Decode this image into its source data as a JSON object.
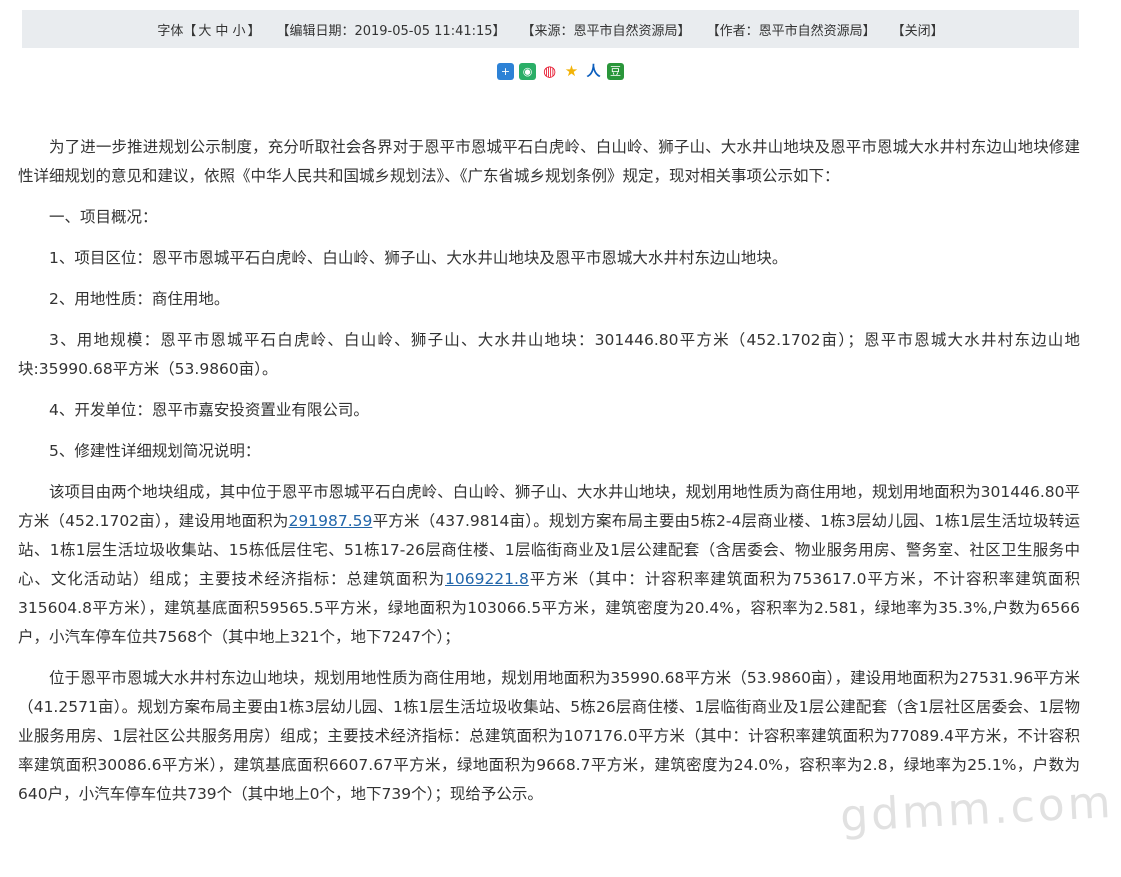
{
  "topbar": {
    "font_label": "字体【",
    "size_large": "大",
    "size_medium": "中",
    "size_small": "小",
    "font_label_end": "】",
    "edit_date": "【编辑日期：2019-05-05 11:41:15】",
    "source": "【来源：恩平市自然资源局】",
    "author": "【作者：恩平市自然资源局】",
    "close": "【关闭】"
  },
  "share": {
    "icons": [
      {
        "name": "share-more-icon",
        "glyph": "+",
        "color": "#2d82d6"
      },
      {
        "name": "wechat-icon",
        "glyph": "◉",
        "color": "#2aae67"
      },
      {
        "name": "weibo-icon",
        "glyph": "◍",
        "color": "#e6162d"
      },
      {
        "name": "qzone-icon",
        "glyph": "★",
        "color": "#f2b308"
      },
      {
        "name": "renren-icon",
        "glyph": "人",
        "color": "#0b5ebd"
      },
      {
        "name": "douban-icon",
        "glyph": "豆",
        "color": "#2a963a"
      }
    ]
  },
  "article": {
    "p1": "为了进一步推进规划公示制度，充分听取社会各界对于恩平市恩城平石白虎岭、白山岭、狮子山、大水井山地块及恩平市恩城大水井村东边山地块修建性详细规划的意见和建议，依照《中华人民共和国城乡规划法》、《广东省城乡规划条例》规定，现对相关事项公示如下：",
    "p2": "一、项目概况：",
    "p3": "1、项目区位：恩平市恩城平石白虎岭、白山岭、狮子山、大水井山地块及恩平市恩城大水井村东边山地块。",
    "p4": "2、用地性质：商住用地。",
    "p5": "3、用地规模：恩平市恩城平石白虎岭、白山岭、狮子山、大水井山地块：301446.80平方米（452.1702亩）；恩平市恩城大水井村东边山地块:35990.68平方米（53.9860亩）。",
    "p6": "4、开发单位：恩平市嘉安投资置业有限公司。",
    "p7": "5、修建性详细规划简况说明：",
    "p8_a": "该项目由两个地块组成，其中位于恩平市恩城平石白虎岭、白山岭、狮子山、大水井山地块，规划用地性质为商住用地，规划用地面积为301446.80平方米（452.1702亩），建设用地面积为",
    "p8_link1": "291987.59",
    "p8_b": "平方米（437.9814亩）。规划方案布局主要由5栋2-4层商业楼、1栋3层幼儿园、1栋1层生活垃圾转运站、1栋1层生活垃圾收集站、15栋低层住宅、51栋17-26层商住楼、1层临街商业及1层公建配套（含居委会、物业服务用房、警务室、社区卫生服务中心、文化活动站）组成；主要技术经济指标：总建筑面积为",
    "p8_link2": "1069221.8",
    "p8_c": "平方米（其中：计容积率建筑面积为753617.0平方米，不计容积率建筑面积315604.8平方米），建筑基底面积59565.5平方米，绿地面积为103066.5平方米，建筑密度为20.4%，容积率为2.581，绿地率为35.3%,户数为6566户，小汽车停车位共7568个（其中地上321个，地下7247个）；",
    "p9": "位于恩平市恩城大水井村东边山地块，规划用地性质为商住用地，规划用地面积为35990.68平方米（53.9860亩），建设用地面积为27531.96平方米（41.2571亩）。规划方案布局主要由1栋3层幼儿园、1栋1层生活垃圾收集站、5栋26层商住楼、1层临街商业及1层公建配套（含1层社区居委会、1层物业服务用房、1层社区公共服务用房）组成；主要技术经济指标：总建筑面积为107176.0平方米（其中：计容积率建筑面积为77089.4平方米，不计容积率建筑面积30086.6平方米），建筑基底面积6607.67平方米，绿地面积为9668.7平方米，建筑密度为24.0%，容积率为2.8，绿地率为25.1%，户数为640户，小汽车停车位共739个（其中地上0个，地下739个）；现给予公示。"
  },
  "watermark": "gdmm.com"
}
